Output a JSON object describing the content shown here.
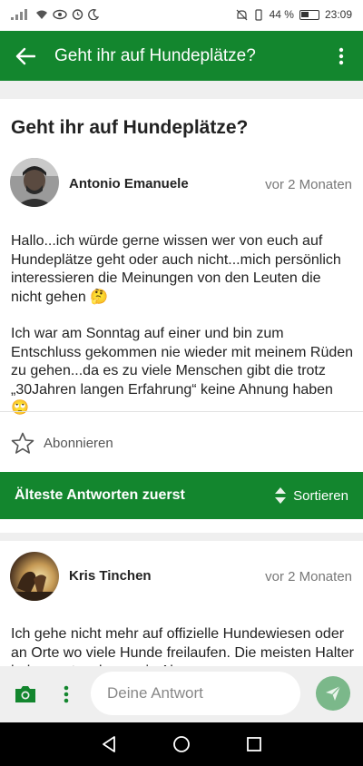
{
  "status_bar": {
    "battery": "44 %",
    "time": "23:09"
  },
  "app_bar": {
    "title": "Geht ihr auf Hundeplätze?"
  },
  "post": {
    "title": "Geht ihr auf Hundeplätze?",
    "author": "Antonio Emanuele",
    "time": "vor 2 Monaten",
    "body_1": "Hallo...ich würde gerne wissen wer von euch auf Hundeplätze geht oder auch nicht...mich persönlich interessieren die Meinungen von den Leuten die nicht gehen 🤔",
    "body_2": "Ich war am Sonntag auf einer und bin zum Entschluss gekommen nie wieder mit meinem Rüden zu gehen...da es zu viele Menschen gibt die trotz „30Jahren langen Erfahrung“ keine Ahnung haben 🙄",
    "subscribe_label": "Abonnieren"
  },
  "sort_bar": {
    "label": "Älteste Antworten zuerst",
    "sort_button": "Sortieren"
  },
  "answer": {
    "author": "Kris Tinchen",
    "time": "vor 2 Monaten",
    "body": "Ich gehe nicht mehr auf offizielle Hundewiesen oder an Orte wo viele Hunde freilaufen. Die meisten Halter haben entweder wenig Ahnung"
  },
  "reply": {
    "placeholder": "Deine Antwort"
  },
  "colors": {
    "primary": "#13862e",
    "send_button": "#7bb88a"
  }
}
